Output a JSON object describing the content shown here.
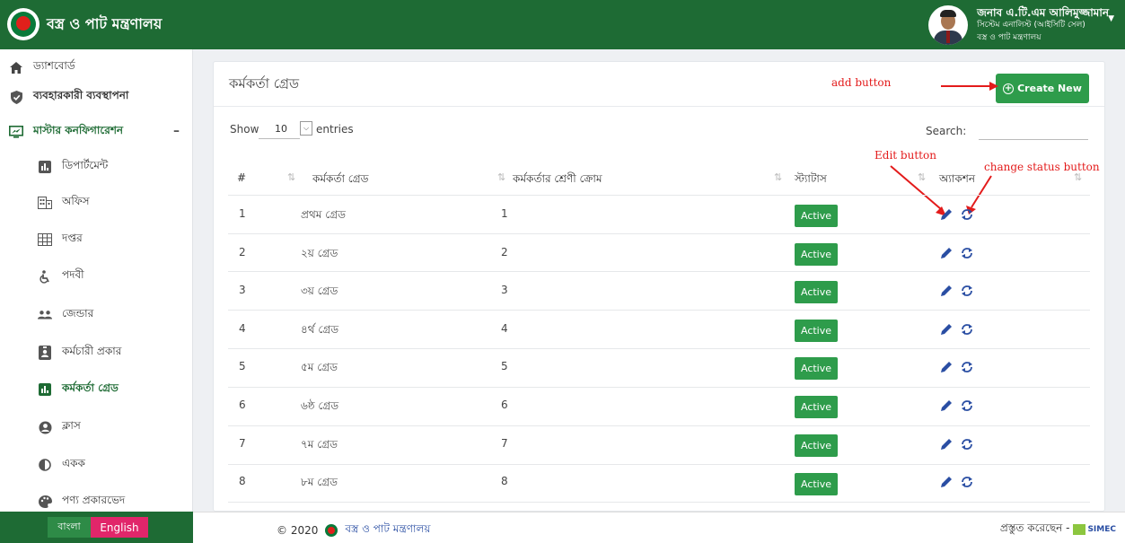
{
  "header": {
    "app_title": "বস্ত্র ও পাট মন্ত্রণালয়",
    "user_name": "জনাব এ.টি.এম আলিমুজ্জামান",
    "user_role": "সিস্টেম এনালিস্ট (আইসিটি সেল)",
    "user_org": "বস্ত্র ও পাট মন্ত্রণালয়"
  },
  "sidebar": {
    "items": [
      {
        "label": "ড্যাশবোর্ড",
        "icon": "home-icon"
      },
      {
        "label": "ব্যবহারকারী ব্যবস্থাপনা",
        "icon": "shield-icon"
      },
      {
        "label": "মাস্টার কনফিগারেশন",
        "icon": "monitor-icon"
      },
      {
        "label": "ডিপার্টমেন্ট",
        "icon": "bar-chart-icon"
      },
      {
        "label": "অফিস",
        "icon": "building-icon"
      },
      {
        "label": "দপ্তর",
        "icon": "grid-icon"
      },
      {
        "label": "পদবী",
        "icon": "accessibility-icon"
      },
      {
        "label": "জেন্ডার",
        "icon": "users-icon"
      },
      {
        "label": "কর্মচারী প্রকার",
        "icon": "id-badge-icon"
      },
      {
        "label": "কর্মকর্তা গ্রেড",
        "icon": "bar-chart-icon"
      },
      {
        "label": "ক্লাস",
        "icon": "user-circle-icon"
      },
      {
        "label": "একক",
        "icon": "adjust-icon"
      },
      {
        "label": "পণ্য প্রকারভেদ",
        "icon": "palette-icon"
      }
    ],
    "collapse_symbol": "–"
  },
  "language": {
    "bangla": "বাংলা",
    "english": "English"
  },
  "page": {
    "title": "কর্মকর্তা গ্রেড",
    "create_label": "Create New",
    "show_label": "Show",
    "entries_value": "10",
    "entries_label": "entries",
    "search_label": "Search:"
  },
  "annotations": {
    "add": "add button",
    "edit": "Edit button",
    "change_status": "change status button"
  },
  "table": {
    "columns": [
      "#",
      "কর্মকর্তা গ্রেড",
      "কর্মকর্তার শ্রেণী ক্রোম",
      "স্ট্যাটাস",
      "অ্যাকশন"
    ],
    "rows": [
      {
        "num": "1",
        "grade": "প্রথম গ্রেড",
        "order": "1",
        "status": "Active"
      },
      {
        "num": "2",
        "grade": "২য় গ্রেড",
        "order": "2",
        "status": "Active"
      },
      {
        "num": "3",
        "grade": "৩য় গ্রেড",
        "order": "3",
        "status": "Active"
      },
      {
        "num": "4",
        "grade": "৪র্থ গ্রেড",
        "order": "4",
        "status": "Active"
      },
      {
        "num": "5",
        "grade": "৫ম গ্রেড",
        "order": "5",
        "status": "Active"
      },
      {
        "num": "6",
        "grade": "৬ষ্ঠ গ্রেড",
        "order": "6",
        "status": "Active"
      },
      {
        "num": "7",
        "grade": "৭ম গ্রেড",
        "order": "7",
        "status": "Active"
      },
      {
        "num": "8",
        "grade": "৮ম গ্রেড",
        "order": "8",
        "status": "Active"
      }
    ]
  },
  "footer": {
    "copyright": "© 2020",
    "org": "বস্ত্র ও পাট মন্ত্রণালয়",
    "made_by": "প্রস্তুত করেছেন -",
    "vendor_logo_text": "SIMEC"
  },
  "colors": {
    "brand_green": "#1e6b34",
    "button_green": "#2e9c4b",
    "english_pink": "#e1266a",
    "annotation_red": "#e31b1b",
    "icon_blue": "#2a4ea3"
  }
}
